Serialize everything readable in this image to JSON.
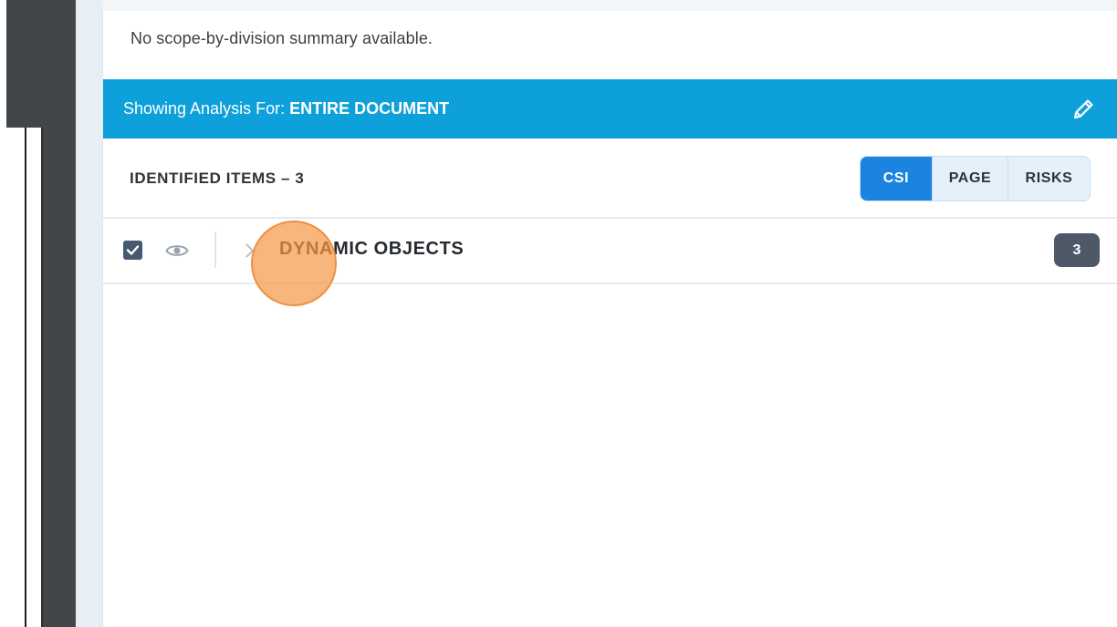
{
  "panel": {
    "summary_text": "No scope-by-division summary available."
  },
  "analysis_bar": {
    "prefix": "Showing Analysis For: ",
    "scope": "ENTIRE DOCUMENT",
    "edit_icon": "pencil-icon",
    "color": "#0ea0da"
  },
  "items": {
    "title": "IDENTIFIED ITEMS – 3",
    "views": [
      {
        "label": "CSI",
        "active": true
      },
      {
        "label": "PAGE",
        "active": false
      },
      {
        "label": "RISKS",
        "active": false
      }
    ],
    "active_color": "#1a84e0",
    "rows": [
      {
        "checked": true,
        "checkbox_icon": "checkmark-icon",
        "visibility_icon": "eye-icon",
        "expand_icon": "chevron-right-icon",
        "label": "DYNAMIC OBJECTS",
        "count": "3"
      }
    ]
  },
  "click_indicator_color": "#f5994a"
}
